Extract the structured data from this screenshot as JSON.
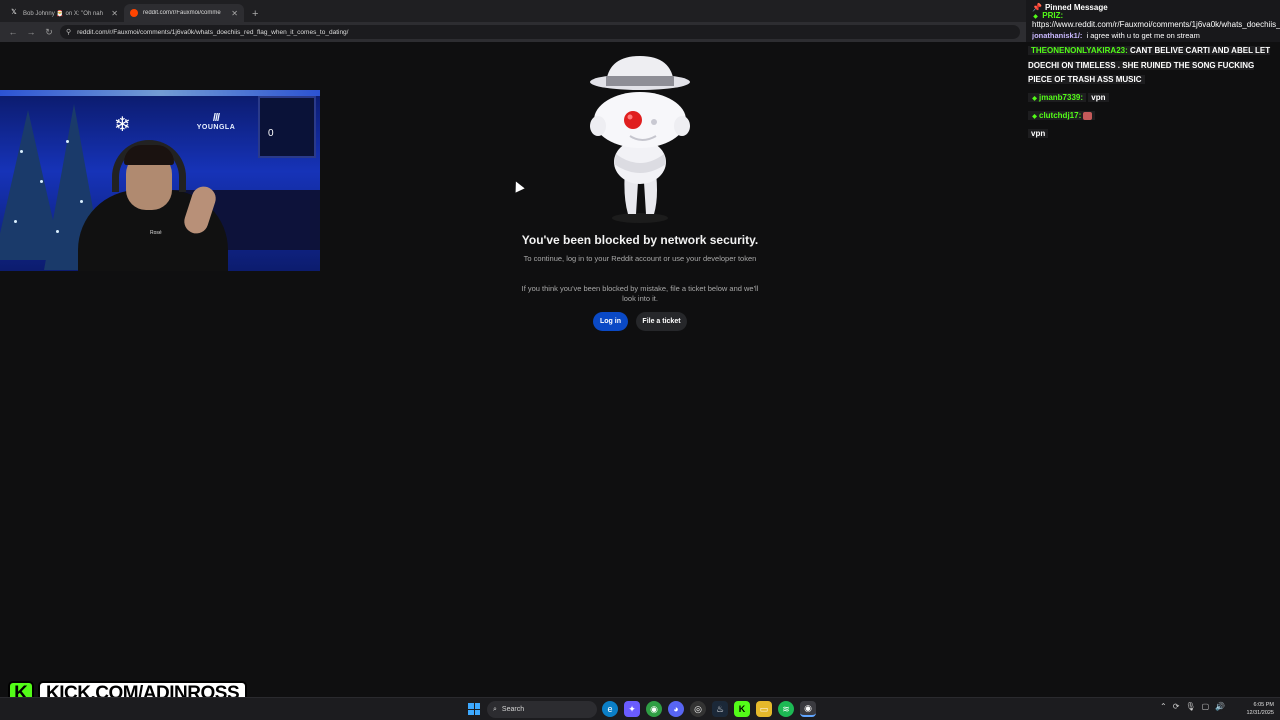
{
  "browser": {
    "tabs": [
      {
        "label": "Bob Johnny 🎅 on X: \"Oh nah",
        "favicon": "x-logo-icon",
        "active": false
      },
      {
        "label": "reddit.com/r/Fauxmoi/comme",
        "favicon": "reddit-icon",
        "active": true
      }
    ],
    "new_tab": "+",
    "url": "reddit.com/r/Fauxmoi/comments/1j6va0k/whats_doechiis_red_flag_when_it_comes_to_dating/"
  },
  "page": {
    "title": "You've been blocked by network security.",
    "subtitle": "To continue, log in to your Reddit account or use your developer token",
    "subtitle2": "If you think you've been blocked by mistake, file a ticket below and we'll look into it.",
    "login_label": "Log in",
    "ticket_label": "File a ticket",
    "accent_color": "#0a49c5"
  },
  "webcam": {
    "wall_logo_text": "YOUNGLA",
    "jersey_number": "0",
    "shirt_tag": "Rosé"
  },
  "chat": {
    "pinned_header": "Pinned Message",
    "pinned_user": "PRIZ:",
    "pinned_text": "https://www.reddit.com/r/Fauxmoi/comments/1j6va0k/whats_doechiis_red_flag_when_it_comes_to_dating/",
    "reply_user": "jonathanisk1/:",
    "reply_text": "i agree with u to get me on stream",
    "messages": [
      {
        "user": "THEONENONLYAKIRA23:",
        "text": "CANT BELIVE CARTI AND ABEL LET DOECHI ON TIMELESS . SHE RUINED THE SONG FUCKING PIECE OF TRASH ASS MUSIC",
        "color": "#53fc18"
      },
      {
        "user": "jmanb7339:",
        "text": "vpn",
        "color": "#53fc18"
      },
      {
        "user": "clutchdj17:",
        "text": "",
        "color": "#53fc18"
      },
      {
        "user": "",
        "text": "vpn",
        "color": "#ffffff"
      }
    ]
  },
  "kick": {
    "letter": "K",
    "banner": "KICK.COM/ADINROSS",
    "brand_color": "#53fc18"
  },
  "taskbar": {
    "search_placeholder": "Search",
    "time": "6:05 PM",
    "date": "12/31/2025"
  }
}
